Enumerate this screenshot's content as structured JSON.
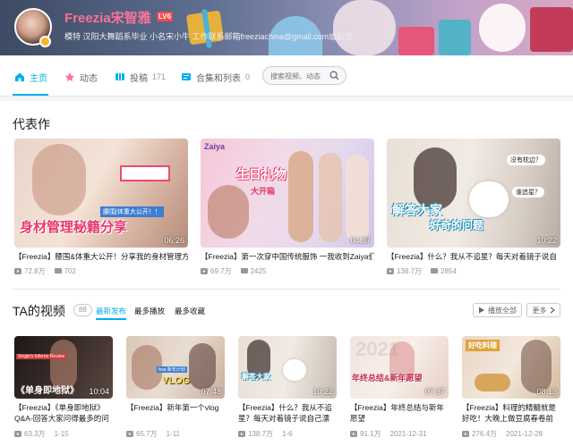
{
  "header": {
    "username": "Freezia宋智雅",
    "gender_symbol": "♀",
    "level": "LV6",
    "sign": "模特 汉阳大舞蹈系毕业 小名宋小牛 工作联系邮箱freeziachina@gmail.com或私信"
  },
  "nav": {
    "tabs": [
      {
        "label": "主页",
        "count": "",
        "icon": "home-icon"
      },
      {
        "label": "动态",
        "count": "",
        "icon": "dynamic-icon"
      },
      {
        "label": "投稿",
        "count": "171",
        "icon": "upload-icon"
      },
      {
        "label": "合集和列表",
        "count": "0",
        "icon": "collection-icon"
      }
    ],
    "search_placeholder": "搜索视频、动态"
  },
  "masterpiece": {
    "title": "代表作",
    "videos": [
      {
        "title": "【Freezia】腰围&体重大公开！分享我的身材管理方",
        "views": "72.8万",
        "comments": "702",
        "duration": "06:26",
        "overlay_text": "身材管理秘籍分享",
        "overlay_sub": "腰围|体重大公开！！"
      },
      {
        "title": "【Freezia】第一次穿中国传统服饰 一我收到Zaiya们",
        "views": "69.7万",
        "comments": "2425",
        "duration": "04:37",
        "overlay_text": "生日礼物",
        "overlay_sub": "大开箱"
      },
      {
        "title": "【Freezia】什么？我从不追星？每天对着镜子说自",
        "views": "138.7万",
        "comments": "2854",
        "duration": "10:22",
        "overlay_text": "解答大家",
        "overlay_sub": "好奇的问题"
      }
    ]
  },
  "my_videos": {
    "title": "TA的视频",
    "count": "88",
    "sorts": [
      "最新发布",
      "最多播放",
      "最多收藏"
    ],
    "play_all": "播放全部",
    "more": "更多",
    "videos": [
      {
        "title": "【Freezia】《单身即地狱》Q&A-回答大家问得最多的问",
        "views": "63.3万",
        "date": "1-15",
        "duration": "10:04",
        "overlay_text": "《单身即地狱》",
        "overlay_sub": "Single's Inferno Review"
      },
      {
        "title": "【Freezia】新年第一个vlog",
        "views": "65.7万",
        "date": "1-11",
        "duration": "07:48",
        "overlay_text": "VLOG",
        "overlay_sub": "feat.新年计划"
      },
      {
        "title": "【Freezia】什么？我从不追星？每天对着镜子说自己漂",
        "views": "138.7万",
        "date": "1-6",
        "duration": "10:22",
        "overlay_text": "解答大家",
        "overlay_sub": ""
      },
      {
        "title": "【Freezia】年终总结与新年愿望",
        "views": "91.1万",
        "date": "2021-12-31",
        "duration": "07:37",
        "overlay_text": "年终总结&新年愿望",
        "overlay_sub": "2021"
      },
      {
        "title": "【Freezia】料理的精髓就是好吃！大晚上做豆腐春卷前饼",
        "views": "276.4万",
        "date": "2021-12-28",
        "duration": "08:13",
        "overlay_text": "好吃料理",
        "overlay_sub": ""
      }
    ]
  },
  "colors": {
    "accent": "#00aeec",
    "username": "#fb7299",
    "level_badge": "#f04c49"
  }
}
